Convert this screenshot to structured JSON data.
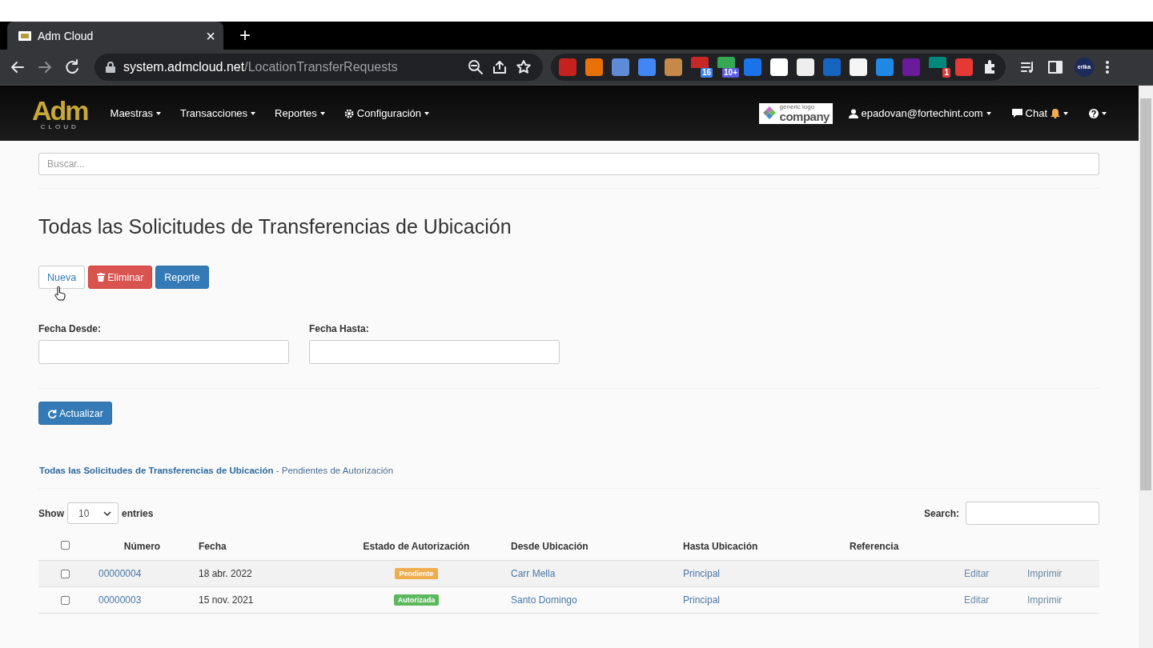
{
  "browser": {
    "tab": {
      "title": "Adm Cloud",
      "close": "×"
    },
    "new_tab": "+",
    "url": {
      "host": "system.admcloud.net",
      "path": "/LocationTransferRequests"
    },
    "extensions": [
      {
        "color": "#c5221f"
      },
      {
        "color": "#e8710a"
      },
      {
        "color": "#5f8bd6"
      },
      {
        "color": "#4285f4"
      },
      {
        "color": "#c58a4a"
      },
      {
        "color": "#c62828",
        "badge": {
          "label": "16",
          "color": "#3b82f6"
        }
      },
      {
        "color": "#34a853",
        "badge": {
          "label": "10+",
          "color": "#5c5ce0"
        }
      },
      {
        "color": "#1a73e8"
      },
      {
        "color": "#ffffff"
      },
      {
        "color": "#eeeeee"
      },
      {
        "color": "#1565c0"
      },
      {
        "color": "#f5f5f5"
      },
      {
        "color": "#1e88e5"
      },
      {
        "color": "#6a1b9a"
      },
      {
        "color": "#00897b",
        "badge": {
          "label": "1",
          "color": "#e53935"
        }
      },
      {
        "color": "#e53935"
      }
    ],
    "profile": "erika"
  },
  "navbar": {
    "logo": {
      "main": "Adm",
      "sub": "CLOUD"
    },
    "menus": [
      {
        "label": "Maestras",
        "kind": "plain"
      },
      {
        "label": "Transacciones",
        "kind": "plain"
      },
      {
        "label": "Reportes",
        "kind": "plain"
      },
      {
        "label": "Configuración",
        "kind": "gear"
      }
    ],
    "company_logo": {
      "small": "generic logo",
      "big": "company"
    },
    "user": "epadovan@fortechint.com",
    "chat": "Chat"
  },
  "page": {
    "search": {
      "placeholder": "Buscar..."
    },
    "title": "Todas las Solicitudes de Transferencias de Ubicación",
    "buttons": [
      {
        "label": "Nueva",
        "kind": "default"
      },
      {
        "label": "Eliminar",
        "kind": "danger"
      },
      {
        "label": "Reporte",
        "kind": "primary"
      }
    ],
    "filters": [
      {
        "label": "Fecha Desde:"
      },
      {
        "label": "Fecha Hasta:"
      }
    ],
    "refresh": "Actualizar",
    "panel_heading": "**Todas las Solicitudes de Transferencias de Ubicación** - Pendientes de Autorización",
    "table": {
      "show_label": "Show",
      "page_size": "10",
      "entries_label": "entries",
      "search_label": "Search:",
      "header_checkbox": {
        "checked": false
      },
      "columns": [
        "Número",
        "Fecha",
        "Estado de Autorización",
        "Desde Ubicación",
        "Hasta Ubicación",
        "Referencia"
      ],
      "rows": [
        {
          "checked": false,
          "number": "00000004",
          "date": "18 abr. 2022",
          "status": {
            "label": "Pendiente",
            "color": "#f0ad4e"
          },
          "from": "Carr Mella",
          "to": "Principal",
          "actions": [
            "Editar",
            "Imprimir"
          ]
        },
        {
          "checked": false,
          "number": "00000003",
          "date": "15 nov. 2021",
          "status": {
            "label": "Autorizada",
            "color": "#5cb85c"
          },
          "from": "Santo Domingo",
          "to": "Principal",
          "actions": [
            "Editar",
            "Imprimir"
          ]
        }
      ]
    }
  }
}
